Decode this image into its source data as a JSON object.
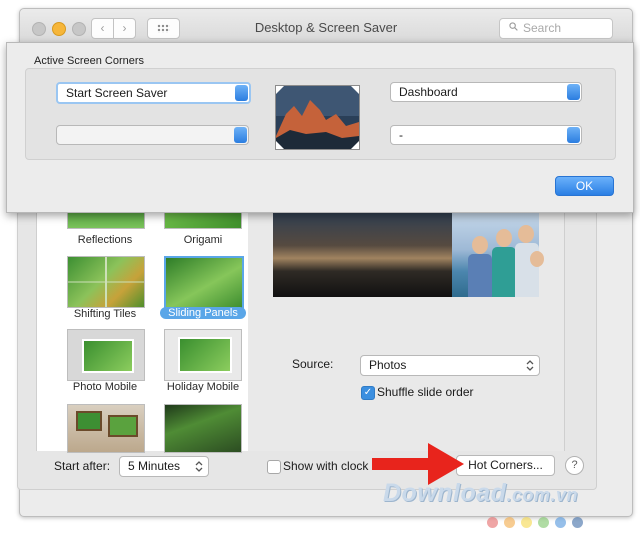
{
  "window": {
    "title": "Desktop & Screen Saver",
    "search_placeholder": "Search"
  },
  "screensavers": [
    {
      "label": "Reflections",
      "selected": false
    },
    {
      "label": "Origami",
      "selected": false
    },
    {
      "label": "Shifting Tiles",
      "selected": false
    },
    {
      "label": "Sliding Panels",
      "selected": true
    },
    {
      "label": "Photo Mobile",
      "selected": false
    },
    {
      "label": "Holiday Mobile",
      "selected": false
    }
  ],
  "source": {
    "label": "Source:",
    "value": "Photos"
  },
  "shuffle": {
    "label": "Shuffle slide order",
    "checked": true
  },
  "start_after": {
    "label": "Start after:",
    "value": "5 Minutes"
  },
  "show_clock": {
    "label": "Show with clock",
    "checked": false
  },
  "hot_corners_button": "Hot Corners...",
  "help_button": "?",
  "sheet": {
    "title": "Active Screen Corners",
    "top_left": "Start Screen Saver",
    "top_right": "Dashboard",
    "bottom_left": "",
    "bottom_right": "-",
    "ok_label": "OK"
  },
  "watermark": {
    "main": "Download",
    "suffix": ".com.vn"
  },
  "colors": {
    "accent_blue": "#2b7de0",
    "selection_blue": "#5aa6e8",
    "annotation_red": "#e8241c",
    "watermark_dots": [
      "#e15b5b",
      "#f0a336",
      "#f4d33b",
      "#6fbf5a",
      "#3f8ad8",
      "#2e5f9e"
    ]
  }
}
